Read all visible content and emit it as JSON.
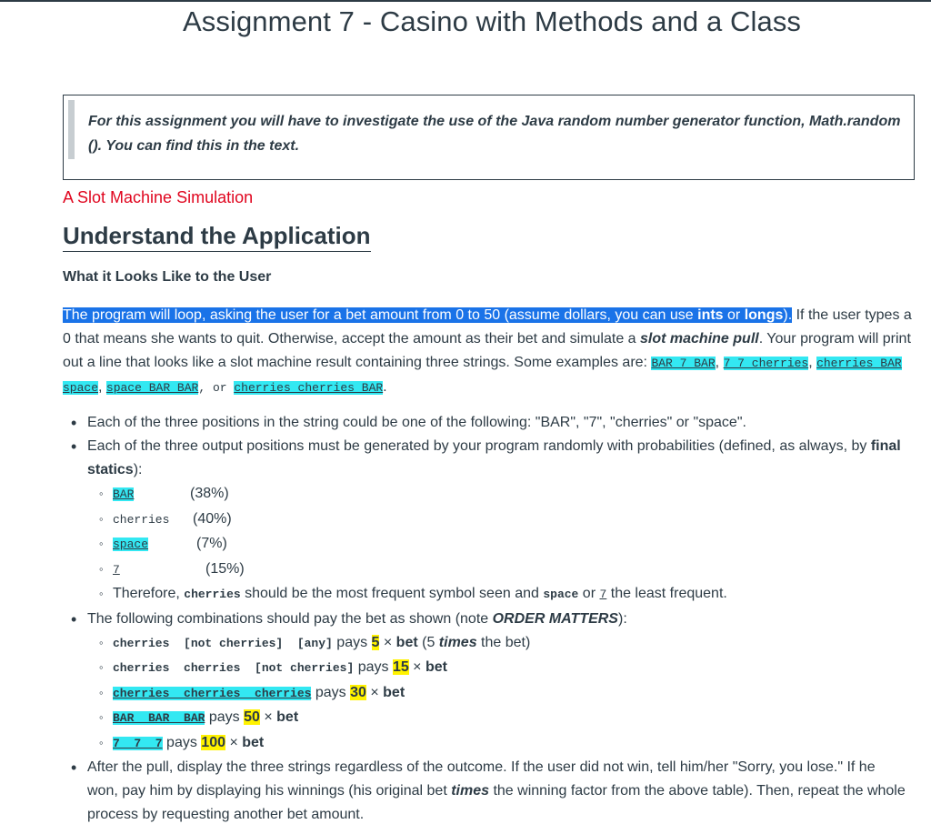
{
  "page": {
    "title": "Assignment 7 - Casino with Methods and a Class"
  },
  "intro": {
    "text_line1": "For this assignment you will have to investigate the use of the Java random number generator function, Math.random",
    "text_line2": "(). You can find this in the text."
  },
  "section": {
    "red_heading": "A Slot Machine Simulation",
    "h2": "Understand the Application",
    "h4": "What it Looks Like to the User"
  },
  "paragraph": {
    "highlight_pre": "The program will loop, asking the user for a bet amount from 0 to 50 (assume dollars, you can use ",
    "highlight_bold1": "ints",
    "highlight_mid": " or ",
    "highlight_bold2": "longs",
    "highlight_post": ").",
    "text1": " If the user types a 0 that means she wants to quit.  Otherwise, accept the amount as their bet and simulate a ",
    "text1_bolditalic": "slot machine pull",
    "text2": ".  Your program will print out a line that looks like a slot machine result containing three strings.  Some examples are: ",
    "examples": [
      "BAR 7 BAR",
      "7 7 cherries",
      "cherries BAR space",
      "space BAR BAR",
      "cherries cherries BAR"
    ],
    "sep": ", ",
    "or": " or ",
    "end": "."
  },
  "bullets": {
    "b1": "Each of the three positions in the string could be one of the following: \"BAR\", \"7\", \"cherries\" or \"space\".",
    "b2_pre": "Each of the three output positions must be generated by your program randomly with probabilities (defined, as always, by ",
    "b2_bold": "final statics",
    "b2_post": "):",
    "probabilities": [
      {
        "symbol": "BAR",
        "percent": "(38%)"
      },
      {
        "symbol": "cherries",
        "percent": "(40%)"
      },
      {
        "symbol": "space",
        "percent": "(7%)"
      },
      {
        "symbol": "7",
        "percent": "(15%)"
      }
    ],
    "therefore_pre": "Therefore, ",
    "therefore_sym1": "cherries",
    "therefore_mid": " should be the most frequent symbol seen and ",
    "therefore_sym2": "space",
    "therefore_or": " or ",
    "therefore_sym3": "7",
    "therefore_post": " the least frequent.",
    "b3_pre": "The following combinations should pay the bet as shown (note ",
    "b3_bolditalic": "ORDER MATTERS",
    "b3_post": "):",
    "payouts": [
      {
        "combo": "cherries  [not cherries]  [any]",
        "pays": " pays ",
        "factor": "5",
        "x": " × ",
        "bet": "bet",
        "extra_pre": " (5 ",
        "extra_italic": "times",
        "extra_post": " the bet)"
      },
      {
        "combo": "cherries  cherries  [not cherries]",
        "pays": " pays ",
        "factor": "15",
        "x": " × ",
        "bet": "bet"
      },
      {
        "combo": "cherries  cherries  cherries",
        "pays": " pays ",
        "factor": "30",
        "x": " × ",
        "bet": "bet"
      },
      {
        "combo": "BAR  BAR  BAR",
        "pays": " pays ",
        "factor": "50",
        "x": " × ",
        "bet": "bet"
      },
      {
        "combo": "7  7  7",
        "pays": " pays ",
        "factor": "100",
        "x": " × ",
        "bet": "bet"
      }
    ],
    "b4_pre": "After the pull, display the three strings regardless of the outcome.  If the user did not win, tell him/her \"Sorry, you lose.\"  If he won, pay him by displaying his winnings (his original bet ",
    "b4_bolditalic": "times",
    "b4_post": " the winning factor from the above table).  Then, repeat the whole process by requesting another bet amount."
  }
}
